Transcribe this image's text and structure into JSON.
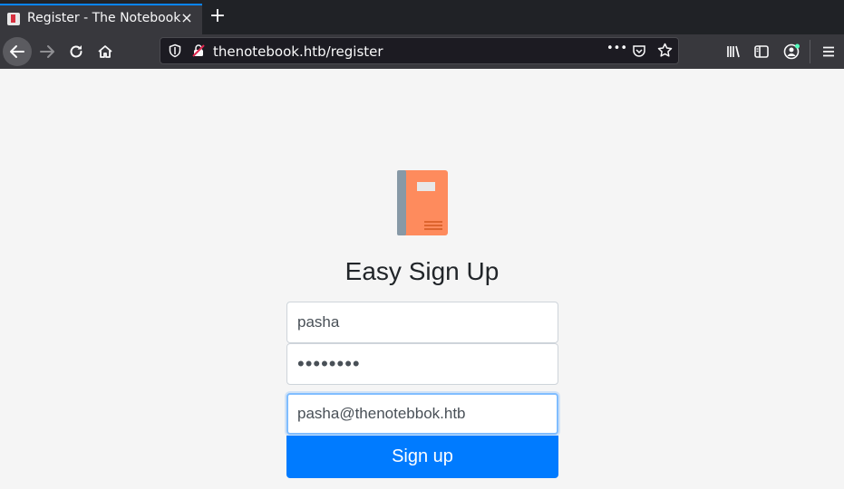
{
  "browser": {
    "tab": {
      "title": "Register - The Notebook",
      "close_icon": "×"
    },
    "new_tab_icon": "+",
    "url": "thenotebook.htb/register",
    "urlbar_more_icon": "•••"
  },
  "page": {
    "heading": "Easy Sign Up",
    "username_value": "pasha",
    "password_value": "••••••••",
    "email_value": "pasha@thenotebbok.htb",
    "submit_label": "Sign up"
  },
  "colors": {
    "accent": "#007bff",
    "notebook_cover": "#fe8b5d",
    "notebook_spine": "#8799a6",
    "focus_border": "#80bdff"
  }
}
